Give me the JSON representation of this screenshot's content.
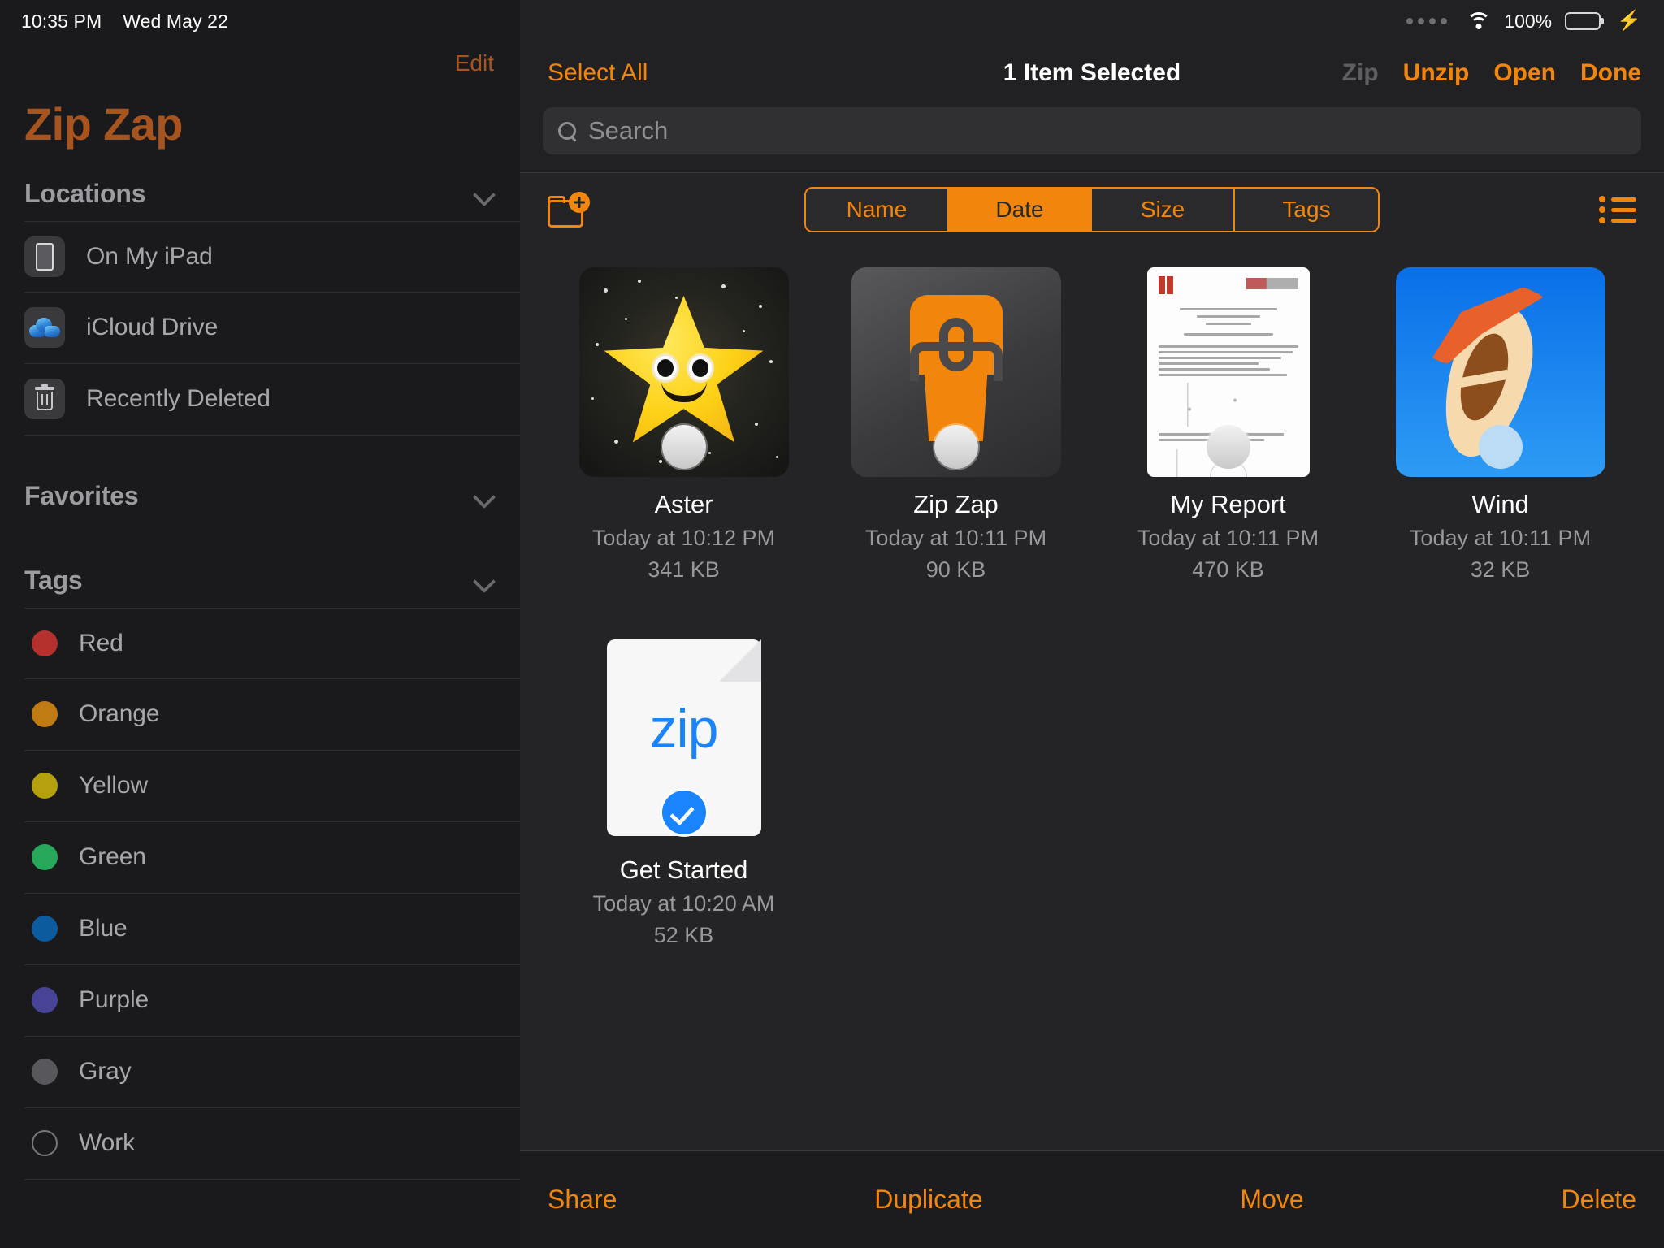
{
  "status_bar": {
    "time": "10:35 PM",
    "date": "Wed May 22",
    "battery_percent": "100%",
    "wifi_icon": "wifi-icon",
    "battery_icon": "battery-icon",
    "charging_icon": "lightning-bolt-icon",
    "signal_dots_icon": "signal-dots-icon"
  },
  "sidebar": {
    "edit_label": "Edit",
    "app_title": "Zip Zap",
    "sections": [
      {
        "title": "Locations",
        "chevron": "chevron-down-icon",
        "items": [
          {
            "label": "On My iPad",
            "icon": "ipad-icon"
          },
          {
            "label": "iCloud Drive",
            "icon": "icloud-icon"
          },
          {
            "label": "Recently Deleted",
            "icon": "trash-icon"
          }
        ]
      },
      {
        "title": "Favorites",
        "chevron": "chevron-down-icon",
        "items": []
      },
      {
        "title": "Tags",
        "chevron": "chevron-down-icon",
        "items": [
          {
            "label": "Red",
            "color": "#b5312d"
          },
          {
            "label": "Orange",
            "color": "#c07b12"
          },
          {
            "label": "Yellow",
            "color": "#b5a10d"
          },
          {
            "label": "Green",
            "color": "#28a85b"
          },
          {
            "label": "Blue",
            "color": "#0c5b9e"
          },
          {
            "label": "Purple",
            "color": "#474396"
          },
          {
            "label": "Gray",
            "color": "#58585c"
          },
          {
            "label": "Work",
            "color": "hollow"
          }
        ]
      }
    ]
  },
  "toolbar": {
    "select_all_label": "Select All",
    "title": "1 Item Selected",
    "actions": [
      {
        "label": "Zip",
        "enabled": false
      },
      {
        "label": "Unzip",
        "enabled": true
      },
      {
        "label": "Open",
        "enabled": true
      },
      {
        "label": "Done",
        "enabled": true
      }
    ]
  },
  "search": {
    "placeholder": "Search",
    "value": "",
    "icon": "search-icon"
  },
  "control_bar": {
    "new_folder_icon": "new-folder-icon",
    "list_view_icon": "list-view-icon",
    "sort_segments": [
      {
        "label": "Name",
        "active": false
      },
      {
        "label": "Date",
        "active": true
      },
      {
        "label": "Size",
        "active": false
      },
      {
        "label": "Tags",
        "active": false
      }
    ]
  },
  "files": [
    {
      "name": "Aster",
      "date": "Today at 10:12 PM",
      "size": "341 KB",
      "thumb": "star-app-icon",
      "selected": false
    },
    {
      "name": "Zip Zap",
      "date": "Today at 10:11 PM",
      "size": "90 KB",
      "thumb": "zipper-app-icon",
      "selected": false
    },
    {
      "name": "My Report",
      "date": "Today at 10:11 PM",
      "size": "470 KB",
      "thumb": "document-preview",
      "selected": false
    },
    {
      "name": "Wind",
      "date": "Today at 10:11 PM",
      "size": "32 KB",
      "thumb": "wind-app-icon",
      "selected": false
    },
    {
      "name": "Get Started",
      "date": "Today at 10:20 AM",
      "size": "52 KB",
      "thumb": "zip-file-icon",
      "selected": true,
      "badge_text": "zip"
    }
  ],
  "bottom_bar": {
    "items": [
      "Share",
      "Duplicate",
      "Move",
      "Delete"
    ]
  },
  "colors": {
    "accent_orange": "#f2860c",
    "dim_orange": "#a8541e",
    "selection_blue": "#1a84ff",
    "battery_green": "#32d74b",
    "disabled_gray": "#5e5e63"
  }
}
